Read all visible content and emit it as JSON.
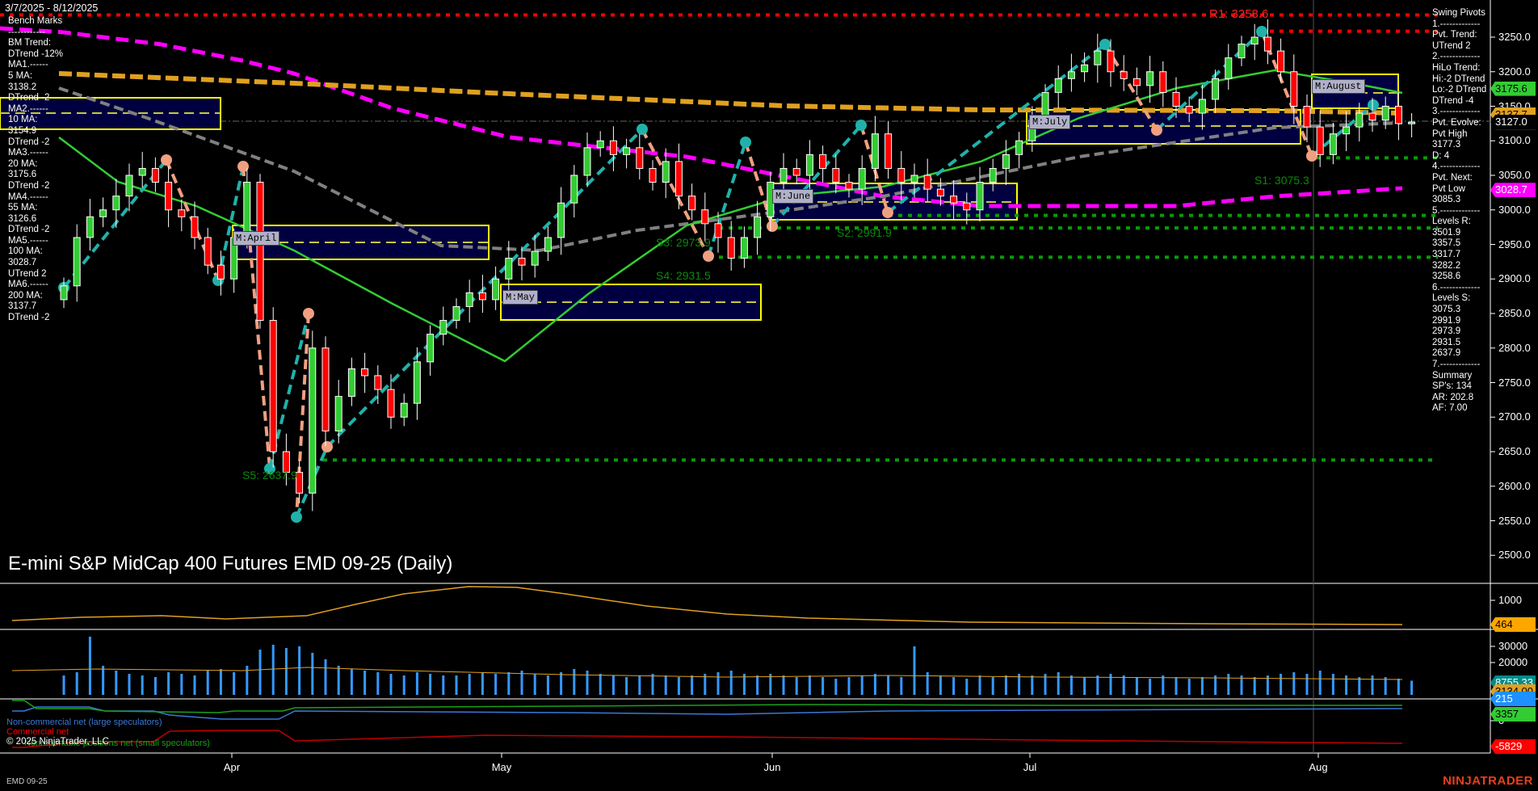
{
  "header": {
    "date_range": "3/7/2025 - 8/12/2025"
  },
  "left_panel": [
    "Bench Marks",
    "------------",
    "BM Trend:",
    "DTrend -12%",
    "MA1.------",
    "5 MA:",
    "3138.2",
    "DTrend -2",
    "MA2.------",
    "10 MA:",
    "3154.9",
    "DTrend -2",
    "MA3.------",
    "20 MA:",
    "3175.6",
    "DTrend -2",
    "MA4.------",
    "55 MA:",
    "3126.6",
    "DTrend -2",
    "MA5.------",
    "100 MA:",
    "3028.7",
    "UTrend 2",
    "MA6.------",
    "200 MA:",
    "3137.7",
    "DTrend -2"
  ],
  "right_panel": [
    "Swing Pivots",
    "1.-------------",
    "Pvt. Trend:",
    "UTrend 2",
    "2.-------------",
    "HiLo Trend:",
    "Hi:-2 DTrend",
    "Lo:-2 DTrend",
    "DTrend -4",
    "3.-------------",
    "Pvt. Evolve:",
    "Pvt High",
    "3177.3",
    "D: 4",
    "4.-------------",
    "Pvt. Next:",
    "Pvt Low",
    "3085.3",
    "5.-------------",
    "Levels R:",
    "3501.9",
    "3357.5",
    "3317.7",
    "3282.2",
    "3258.6",
    "6.-------------",
    "Levels S:",
    "3075.3",
    "2991.9",
    "2973.9",
    "2931.5",
    "2637.9",
    "7.-------------",
    "Summary",
    "SP's: 134",
    "AR: 202.8",
    "AF: 7.00"
  ],
  "title": "E-mini S&P MidCap 400 Futures EMD 09-25 (Daily)",
  "instrument_tab": "EMD 09-25",
  "copyright": "© 2025 NinjaTrader, LLC",
  "logo": "NINJATRADER",
  "colors": {
    "up": "#33cc33",
    "down": "#ff0000",
    "ma20": "#33cc33",
    "ma55": "#808080",
    "ma100": "#ff00ff",
    "ma200": "#e0a020",
    "support": "#0a8a0a",
    "resistance": "#ff0000",
    "volume": "#3399ff"
  },
  "chart_data": {
    "type": "candlestick",
    "title": "E-mini S&P MidCap 400 Futures EMD 09-25 (Daily)",
    "y_ticks": [
      "3250.0",
      "3200.0",
      "3150.0",
      "3100.0",
      "3050.0",
      "3000.0",
      "2950.0",
      "2900.0",
      "2850.0",
      "2800.0",
      "2750.0",
      "2700.0",
      "2650.0",
      "2600.0",
      "2550.0",
      "2500.0"
    ],
    "x_ticks": [
      "Apr",
      "May",
      "Jun",
      "Jul",
      "Aug"
    ],
    "closes": [
      2890,
      2960,
      2990,
      3000,
      3020,
      3050,
      3060,
      3040,
      3000,
      2990,
      2960,
      2920,
      2900,
      2960,
      3040,
      2840,
      2650,
      2620,
      2590,
      2800,
      2680,
      2730,
      2770,
      2760,
      2740,
      2700,
      2720,
      2780,
      2820,
      2840,
      2860,
      2880,
      2870,
      2900,
      2930,
      2920,
      2940,
      2960,
      3010,
      3050,
      3090,
      3100,
      3080,
      3090,
      3060,
      3040,
      3070,
      3020,
      3000,
      2980,
      2960,
      2930,
      2960,
      2990,
      3040,
      3060,
      3050,
      3080,
      3060,
      3040,
      3030,
      3060,
      3110,
      3060,
      3040,
      3050,
      3030,
      3020,
      3010,
      3000,
      3040,
      3060,
      3080,
      3100,
      3130,
      3170,
      3190,
      3200,
      3210,
      3230,
      3200,
      3190,
      3180,
      3200,
      3170,
      3150,
      3140,
      3160,
      3190,
      3220,
      3240,
      3250,
      3230,
      3200,
      3150,
      3120,
      3080,
      3110,
      3120,
      3140,
      3130,
      3150,
      3125,
      3127
    ],
    "volumes": [
      12000,
      14000,
      36000,
      18000,
      15000,
      13000,
      12000,
      11000,
      14000,
      13000,
      12000,
      15000,
      16000,
      14000,
      18000,
      28000,
      31000,
      29000,
      30000,
      26000,
      22000,
      18000,
      16000,
      15000,
      14000,
      13000,
      12000,
      14000,
      13000,
      12000,
      12000,
      13000,
      14000,
      13000,
      14000,
      15000,
      13000,
      12000,
      14000,
      16000,
      15000,
      13000,
      12000,
      11000,
      12000,
      13000,
      12000,
      11000,
      12000,
      13000,
      14000,
      15000,
      13000,
      12000,
      13000,
      12000,
      11000,
      12000,
      11000,
      10000,
      11000,
      12000,
      13000,
      12000,
      11000,
      30000,
      14000,
      12000,
      11000,
      10000,
      12000,
      11000,
      12000,
      13000,
      12000,
      13000,
      14000,
      12000,
      11000,
      12000,
      13000,
      12000,
      11000,
      10000,
      12000,
      11000,
      10000,
      11000,
      12000,
      13000,
      12000,
      11000,
      12000,
      13000,
      14000,
      13000,
      15000,
      13000,
      12000,
      11000,
      12000,
      11000,
      10000,
      8755
    ],
    "levels": {
      "resistance": [
        {
          "label": "R1: 3258.6",
          "value": 3258.6
        },
        {
          "label": "",
          "value": 3282.2
        }
      ],
      "support": [
        {
          "label": "S1: 3075.3",
          "value": 3075.3
        },
        {
          "label": "S2: 2991.9",
          "value": 2991.9
        },
        {
          "label": "S3: 2973.9",
          "value": 2973.9
        },
        {
          "label": "S4: 2931.5",
          "value": 2931.5
        },
        {
          "label": "S5: 2637.9",
          "value": 2637.9
        }
      ]
    },
    "monthly_boxes": [
      "M:April",
      "M:May",
      "M:June",
      "M:July",
      "M:August"
    ],
    "price_badges": [
      {
        "value": "3175.6",
        "color": "#33cc33",
        "price": 3175.6,
        "text": "#000"
      },
      {
        "value": "3137.7",
        "color": "#e0a020",
        "price": 3137.7,
        "text": "#000"
      },
      {
        "value": "3127.0",
        "color": "#000",
        "price": 3127.0,
        "text": "#fff"
      },
      {
        "value": "3028.7",
        "color": "#ff00ff",
        "price": 3028.7,
        "text": "#fff"
      }
    ],
    "panels": {
      "atr": {
        "ticks": [
          "1000"
        ],
        "badge": "464"
      },
      "volume": {
        "ticks": [
          "30000",
          "20000"
        ],
        "badges": [
          "8755.33",
          "3134.00",
          "215"
        ]
      },
      "cot": {
        "ticks": [
          "0"
        ],
        "badges": [
          "3357",
          "-5829"
        ],
        "legend": [
          "Non-commercial net (large speculators)",
          "Commercial net",
          "Nonreportable positions net (small speculators)"
        ]
      }
    }
  }
}
